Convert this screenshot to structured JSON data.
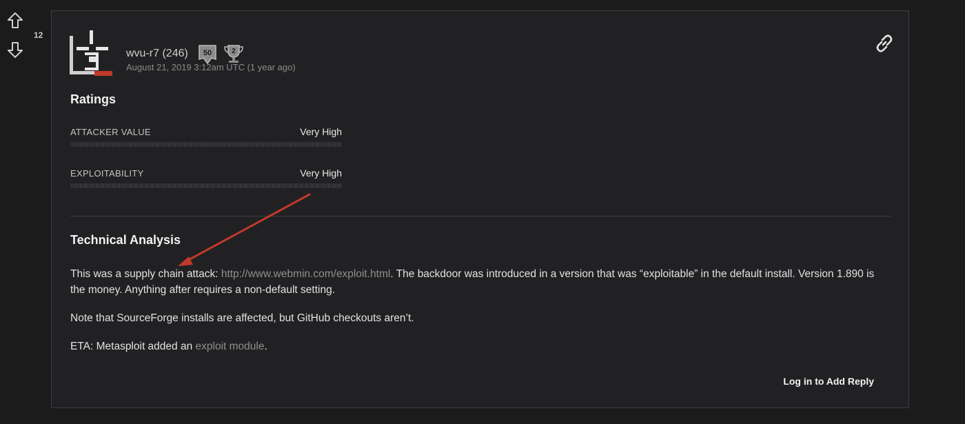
{
  "vote": {
    "count": "12",
    "up_icon": "arrow-up-icon",
    "down_icon": "arrow-down-icon"
  },
  "author": {
    "name": "wvu-r7",
    "reputation": "(246)",
    "badges": [
      {
        "icon": "fifty-badge-icon",
        "text": "50"
      },
      {
        "icon": "trophy-badge-icon",
        "text": "2"
      }
    ],
    "date": "August 21, 2019 3:12am UTC (1 year ago)"
  },
  "ratings": {
    "title": "Ratings",
    "items": [
      {
        "label": "ATTACKER VALUE",
        "value": "Very High",
        "level": 1.0
      },
      {
        "label": "EXPLOITABILITY",
        "value": "Very High",
        "level": 1.0
      }
    ]
  },
  "analysis": {
    "title": "Technical Analysis",
    "p1_before": "This was a supply chain attack: ",
    "p1_link": "http://www.webmin.com/exploit.html",
    "p1_after": ". The backdoor was introduced in a version that was “exploitable” in the default install. Version 1.890 is the money. Anything after requires a non-default setting.",
    "p2": "Note that SourceForge installs are affected, but GitHub checkouts aren’t.",
    "p3_before": "ETA: Metasploit added an ",
    "p3_link": "exploit module",
    "p3_after": "."
  },
  "actions": {
    "reply": "Log in to Add Reply"
  },
  "colors": {
    "annotation_arrow": "#c0392b",
    "background": "#1b1b1c",
    "card": "#212123"
  }
}
